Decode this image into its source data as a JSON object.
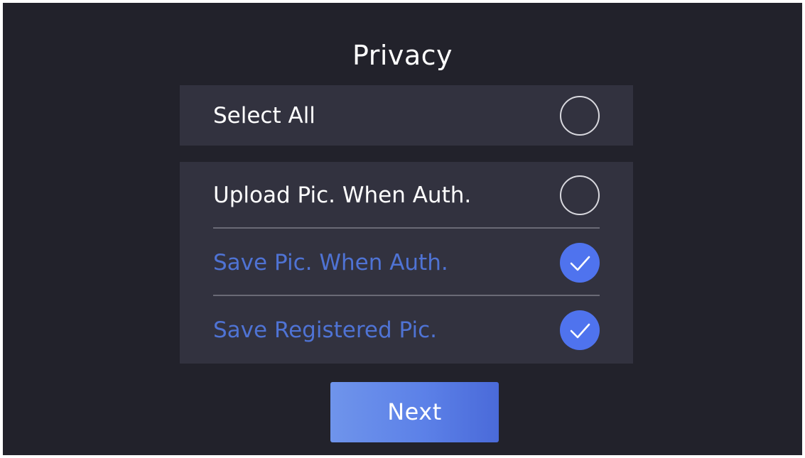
{
  "page": {
    "title": "Privacy"
  },
  "select_all": {
    "label": "Select All",
    "checked": false
  },
  "options": [
    {
      "label": "Upload Pic. When Auth.",
      "checked": false
    },
    {
      "label": "Save Pic. When Auth.",
      "checked": true
    },
    {
      "label": "Save Registered Pic.",
      "checked": true
    }
  ],
  "next_button": {
    "label": "Next"
  },
  "colors": {
    "background": "#22222b",
    "panel": "#32323f",
    "accent": "#4f73ee",
    "checked_text": "#4f73d4"
  },
  "icons": {
    "unchecked": "empty-circle-icon",
    "checked": "checkmark-circle-icon"
  }
}
